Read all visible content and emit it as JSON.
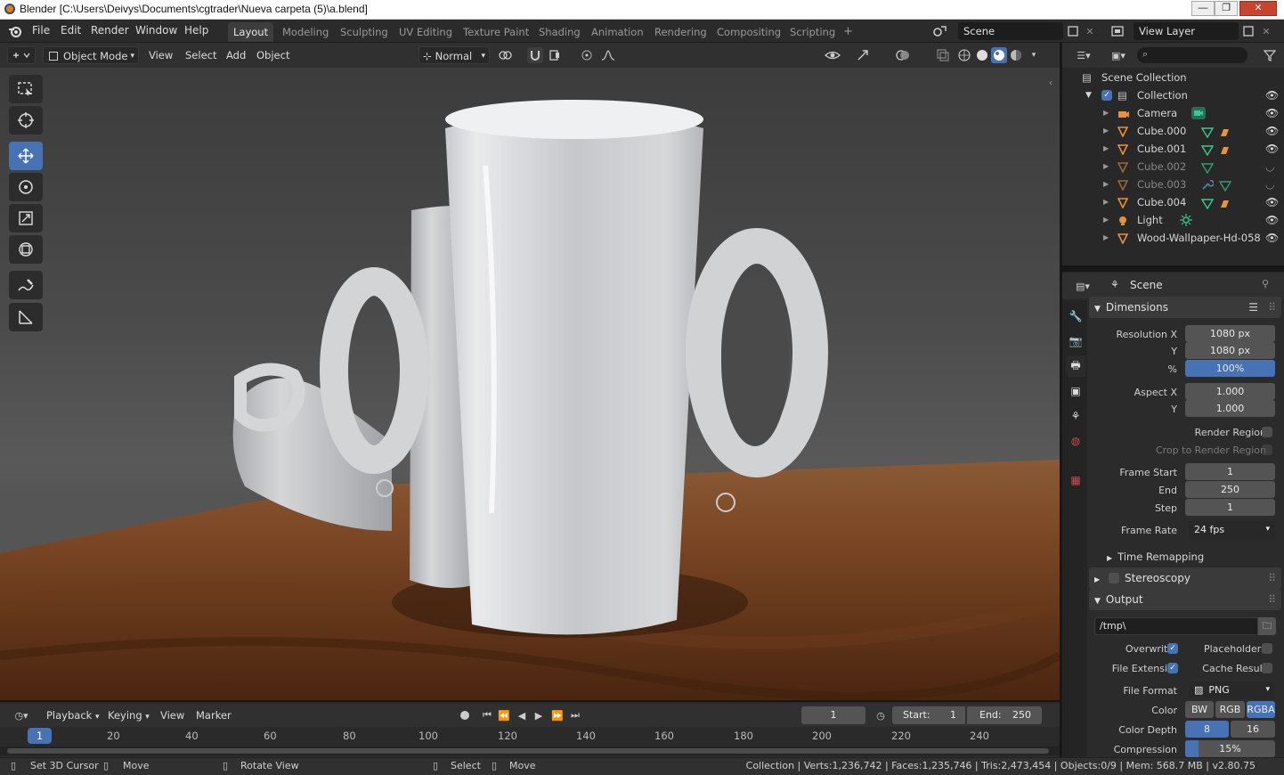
{
  "window": {
    "title": "Blender [C:\\Users\\Deivys\\Documents\\cgtrader\\Nueva carpeta (5)\\a.blend]",
    "minimize": "—",
    "maximize": "❐",
    "close": "✕"
  },
  "menus": [
    "File",
    "Edit",
    "Render",
    "Window",
    "Help"
  ],
  "workspaces": [
    "Layout",
    "Modeling",
    "Sculpting",
    "UV Editing",
    "Texture Paint",
    "Shading",
    "Animation",
    "Rendering",
    "Compositing",
    "Scripting"
  ],
  "workspace_add": "+",
  "scene_name": "Scene",
  "view_layer_name": "View Layer",
  "viewport_header": {
    "mode": "Object Mode",
    "menus": [
      "View",
      "Select",
      "Add",
      "Object"
    ],
    "orientation": "Normal"
  },
  "outliner": {
    "root": "Scene Collection",
    "collection": "Collection",
    "items": [
      {
        "name": "Camera",
        "visible": true
      },
      {
        "name": "Cube.000",
        "visible": true
      },
      {
        "name": "Cube.001",
        "visible": true
      },
      {
        "name": "Cube.002",
        "visible": false
      },
      {
        "name": "Cube.003",
        "visible": false
      },
      {
        "name": "Cube.004",
        "visible": true
      },
      {
        "name": "Light",
        "visible": true
      },
      {
        "name": "Wood-Wallpaper-Hd-058",
        "visible": true
      }
    ]
  },
  "properties": {
    "context": "Scene",
    "dimensions": {
      "header": "Dimensions",
      "resolution_x_label": "Resolution X",
      "resolution_x": "1080 px",
      "y_label": "Y",
      "resolution_y": "1080 px",
      "percent_label": "%",
      "percent": "100%",
      "aspect_x_label": "Aspect X",
      "aspect_x": "1.000",
      "aspect_y_label": "Y",
      "aspect_y": "1.000",
      "render_region": "Render Region",
      "crop_region": "Crop to Render Region",
      "frame_start_label": "Frame Start",
      "frame_start": "1",
      "end_label": "End",
      "frame_end": "250",
      "step_label": "Step",
      "frame_step": "1",
      "frame_rate_label": "Frame Rate",
      "frame_rate": "24 fps",
      "time_remapping": "Time Remapping"
    },
    "stereoscopy": "Stereoscopy",
    "output": {
      "header": "Output",
      "path": "/tmp\\",
      "overwrite": "Overwrite",
      "placeholders": "Placeholders",
      "file_extensions": "File Extensi..",
      "cache_result": "Cache Result",
      "file_format_label": "File Format",
      "file_format": "PNG",
      "color_label": "Color",
      "color_options": [
        "BW",
        "RGB",
        "RGBA"
      ],
      "color_depth_label": "Color Depth",
      "color_depth_options": [
        "8",
        "16"
      ],
      "compression_label": "Compression",
      "compression": "15%"
    }
  },
  "timeline": {
    "menus": [
      "Playback",
      "Keying",
      "View",
      "Marker"
    ],
    "current_frame": "1",
    "start_label": "Start:",
    "start": "1",
    "end_label": "End:",
    "end": "250",
    "ruler": [
      "1",
      "20",
      "40",
      "60",
      "80",
      "100",
      "120",
      "140",
      "160",
      "180",
      "200",
      "220",
      "240"
    ]
  },
  "statusbar": {
    "hint1": "Set 3D Cursor",
    "hint2": "Move",
    "hint3": "Rotate View",
    "hint4": "Select",
    "hint5": "Move",
    "stats": "Collection | Verts:1,236,742 | Faces:1,235,746 | Tris:2,473,454 | Objects:0/9 | Mem: 568.7 MB | v2.80.75"
  },
  "colors": {
    "accent": "#4772b3",
    "mesh_icon": "#e8913f",
    "data_icon": "#39c98f"
  }
}
